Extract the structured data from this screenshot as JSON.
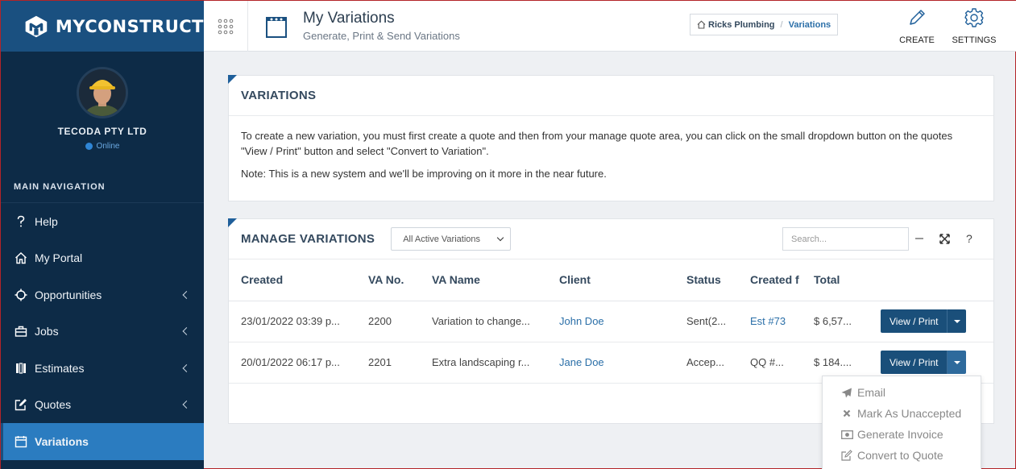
{
  "brand": {
    "name": "MYCONSTRUCT"
  },
  "profile": {
    "company": "TECODA PTY LTD",
    "status": "Online"
  },
  "nav": {
    "header": "MAIN NAVIGATION",
    "items": [
      {
        "label": "Help",
        "icon": "question-icon",
        "chevron": false
      },
      {
        "label": "My Portal",
        "icon": "home-icon",
        "chevron": false
      },
      {
        "label": "Opportunities",
        "icon": "crosshair-icon",
        "chevron": true
      },
      {
        "label": "Jobs",
        "icon": "toolbox-icon",
        "chevron": true
      },
      {
        "label": "Estimates",
        "icon": "estimates-icon",
        "chevron": true
      },
      {
        "label": "Quotes",
        "icon": "edit-icon",
        "chevron": true
      },
      {
        "label": "Variations",
        "icon": "calendar-icon",
        "chevron": false,
        "active": true
      }
    ]
  },
  "header": {
    "title": "My Variations",
    "subtitle": "Generate, Print & Send Variations",
    "breadcrumb": [
      "Ricks Plumbing",
      "Variations"
    ],
    "create_label": "CREATE",
    "settings_label": "SETTINGS"
  },
  "info_panel": {
    "title": "VARIATIONS",
    "paragraph1": "To create a new variation, you must first create a quote and then from your manage quote area, you can click on the small dropdown button on the quotes \"View / Print\" button and select \"Convert to Variation\".",
    "paragraph2": "Note: This is a new system and we'll be improving on it more in the near future."
  },
  "manage_panel": {
    "title": "MANAGE VARIATIONS",
    "filter_value": "All Active Variations",
    "search_placeholder": "Search...",
    "columns": [
      "Created",
      "VA No.",
      "VA Name",
      "Client",
      "Status",
      "Created f",
      "Total"
    ],
    "rows": [
      {
        "created": "23/01/2022 03:39 p...",
        "va_no": "2200",
        "va_name": "Variation to change...",
        "client": "John Doe",
        "status": "Sent(2...",
        "created_from": "Est #73",
        "total": "$ 6,57...",
        "action": "View / Print"
      },
      {
        "created": "20/01/2022 06:17 p...",
        "va_no": "2201",
        "va_name": "Extra landscaping r...",
        "client": "Jane Doe",
        "status": "Accep...",
        "created_from": "QQ #...",
        "total": "$ 184....",
        "action": "View / Print"
      }
    ]
  },
  "dropdown": {
    "items": [
      {
        "label": "Email",
        "icon": "send-icon"
      },
      {
        "label": "Mark As Unaccepted",
        "icon": "x-icon"
      },
      {
        "label": "Generate Invoice",
        "icon": "money-icon"
      },
      {
        "label": "Convert to Quote",
        "icon": "edit-icon"
      }
    ]
  },
  "colors": {
    "sidebar": "#0d2b47",
    "logo_bar": "#1a5080",
    "active_nav": "#2b7cc0",
    "button": "#1a4f7a",
    "link": "#2b6fa8"
  }
}
